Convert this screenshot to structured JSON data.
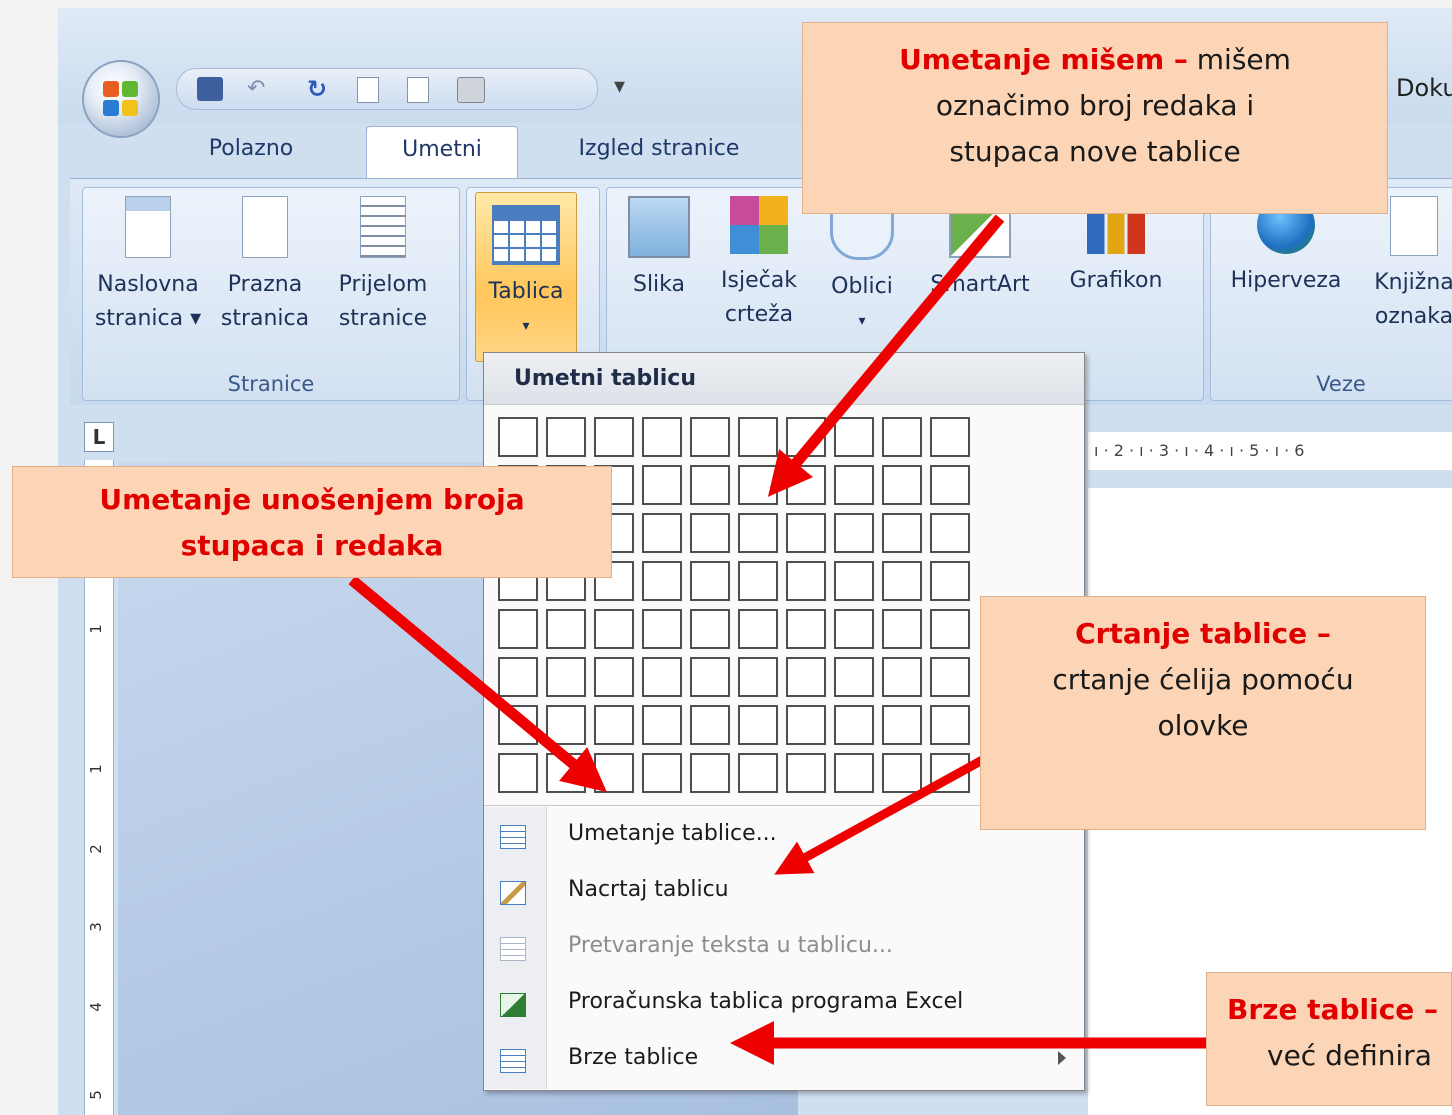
{
  "window": {
    "doc_title": "Doku",
    "tabs": [
      "Polazno",
      "Umetni",
      "Izgled stranice"
    ],
    "active_tab": "Umetni"
  },
  "ribbon": {
    "groups": [
      {
        "label": "Stranice"
      },
      {
        "label": "Veze"
      }
    ],
    "buttons": {
      "naslovna": [
        "Naslovna",
        "stranica ▾"
      ],
      "prazna": [
        "Prazna",
        "stranica"
      ],
      "prijelom": [
        "Prijelom",
        "stranice"
      ],
      "tablica": [
        "Tablica",
        "▾"
      ],
      "slika": [
        "Slika",
        ""
      ],
      "isjecak": [
        "Isječak",
        "crteža"
      ],
      "oblici": [
        "Oblici",
        "▾"
      ],
      "smartart": [
        "SmartArt",
        ""
      ],
      "grafikon": [
        "Grafikon",
        ""
      ],
      "hiperveza": [
        "Hiperveza",
        ""
      ],
      "knjizna": [
        "Knjižna",
        "oznaka"
      ]
    }
  },
  "ruler": {
    "h_ticks": "ı · 2 · ı · 3 · ı · 4 · ı · 5 · ı · 6",
    "v_numbers": [
      "1",
      "1",
      "2",
      "3",
      "4",
      "5"
    ],
    "corner": "L"
  },
  "menu": {
    "header": "Umetni tablicu",
    "grid_cols": 10,
    "grid_rows": 8,
    "items": [
      {
        "label": "Umetanje tablice...",
        "disabled": false,
        "icon": "table-icon"
      },
      {
        "label": "Nacrtaj tablicu",
        "disabled": false,
        "icon": "pencil-table-icon"
      },
      {
        "label": "Pretvaranje teksta u tablicu...",
        "disabled": true,
        "icon": "convert-text-icon"
      },
      {
        "label": "Proračunska tablica programa Excel",
        "disabled": false,
        "icon": "excel-icon"
      },
      {
        "label": "Brze tablice",
        "disabled": false,
        "icon": "quick-table-icon",
        "submenu": true
      }
    ]
  },
  "callouts": {
    "mouse": {
      "title": "Umetanje mišem –",
      "rest_1": " mišem",
      "line2": "označimo broj redaka i",
      "line3": "stupaca nove tablice"
    },
    "enter": {
      "line1": "Umetanje unošenjem broja",
      "line2": "stupaca i redaka"
    },
    "draw": {
      "title": "Crtanje tablice –",
      "line2": "crtanje ćelija pomoću",
      "line3": "olovke"
    },
    "quick": {
      "title": "Brze tablice –",
      "line2": "već definira"
    }
  },
  "colors": {
    "callout_bg": "#fbd5b5",
    "callout_title": "#e10000",
    "arrow": "#ee0000",
    "tablica_highlight": "#ffc65a"
  }
}
